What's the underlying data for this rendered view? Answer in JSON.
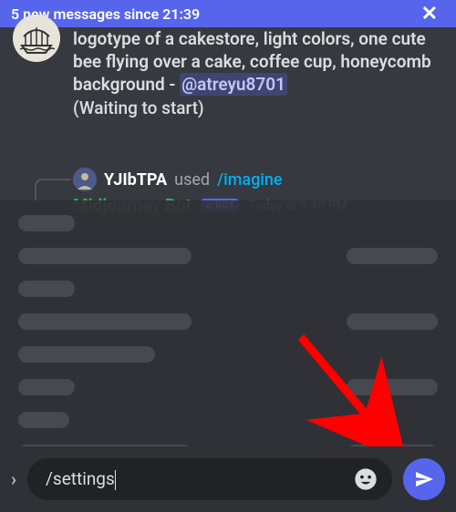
{
  "banner": {
    "text": "5 new messages since 21:39",
    "close_glyph": "✕"
  },
  "message1": {
    "body_plain_prefix": "logotype of a cakestore, light colors, one cute bee flying over a cake, coffee cup, honeycomb background - ",
    "mention": "@atreyu8701",
    "waiting": "(Waiting to start)"
  },
  "message2": {
    "username": "YJIbTPA",
    "verb": "used",
    "command": "/imagine"
  },
  "message3": {
    "bot_name": "Midjourney Bot",
    "bot_tag_check": "✓",
    "bot_tag_text": "BOT",
    "timestamp": "Today at 9:40 PM"
  },
  "composer": {
    "chevron": "›",
    "input_value": "/settings"
  }
}
